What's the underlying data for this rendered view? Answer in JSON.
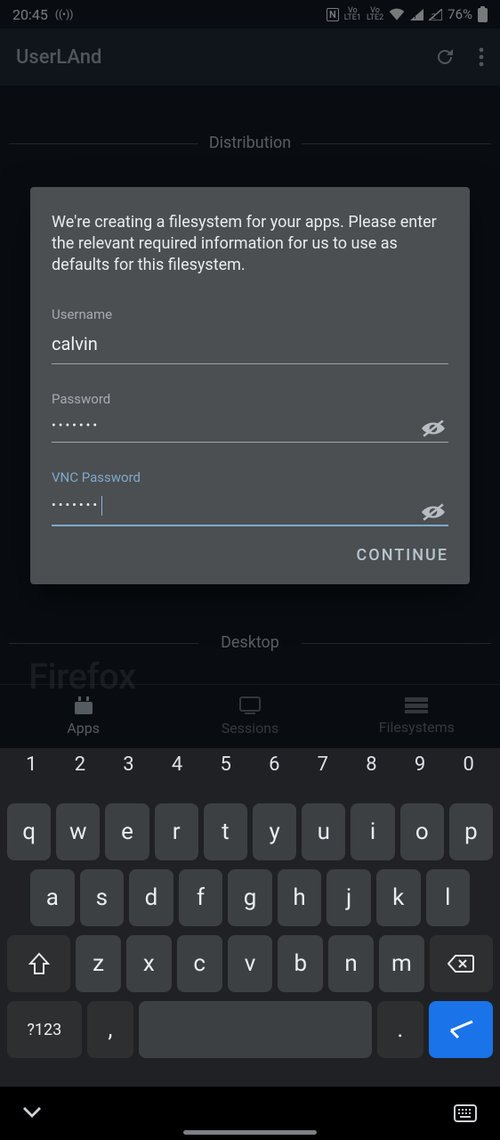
{
  "status": {
    "time": "20:45",
    "battery": "76%"
  },
  "appbar": {
    "title": "UserLAnd"
  },
  "sections": {
    "distribution": "Distribution",
    "desktop": "Desktop"
  },
  "bg": {
    "firefox": "Firefox"
  },
  "dialog": {
    "message": "We're creating a filesystem for your apps. Please enter the relevant required information for us to use as defaults for this filesystem.",
    "username_label": "Username",
    "username_value": "calvin",
    "password_label": "Password",
    "password_value": "•••••••",
    "vnc_label": "VNC Password",
    "vnc_value": "•••••••",
    "continue": "CONTINUE"
  },
  "bottomnav": {
    "apps": "Apps",
    "sessions": "Sessions",
    "filesystems": "Filesystems"
  },
  "keyboard": {
    "numbers": [
      "1",
      "2",
      "3",
      "4",
      "5",
      "6",
      "7",
      "8",
      "9",
      "0"
    ],
    "row1": [
      "q",
      "w",
      "e",
      "r",
      "t",
      "y",
      "u",
      "i",
      "o",
      "p"
    ],
    "row2": [
      "a",
      "s",
      "d",
      "f",
      "g",
      "h",
      "j",
      "k",
      "l"
    ],
    "row3": [
      "z",
      "x",
      "c",
      "v",
      "b",
      "n",
      "m"
    ],
    "sym": "?123",
    "comma": ",",
    "dot": "."
  }
}
